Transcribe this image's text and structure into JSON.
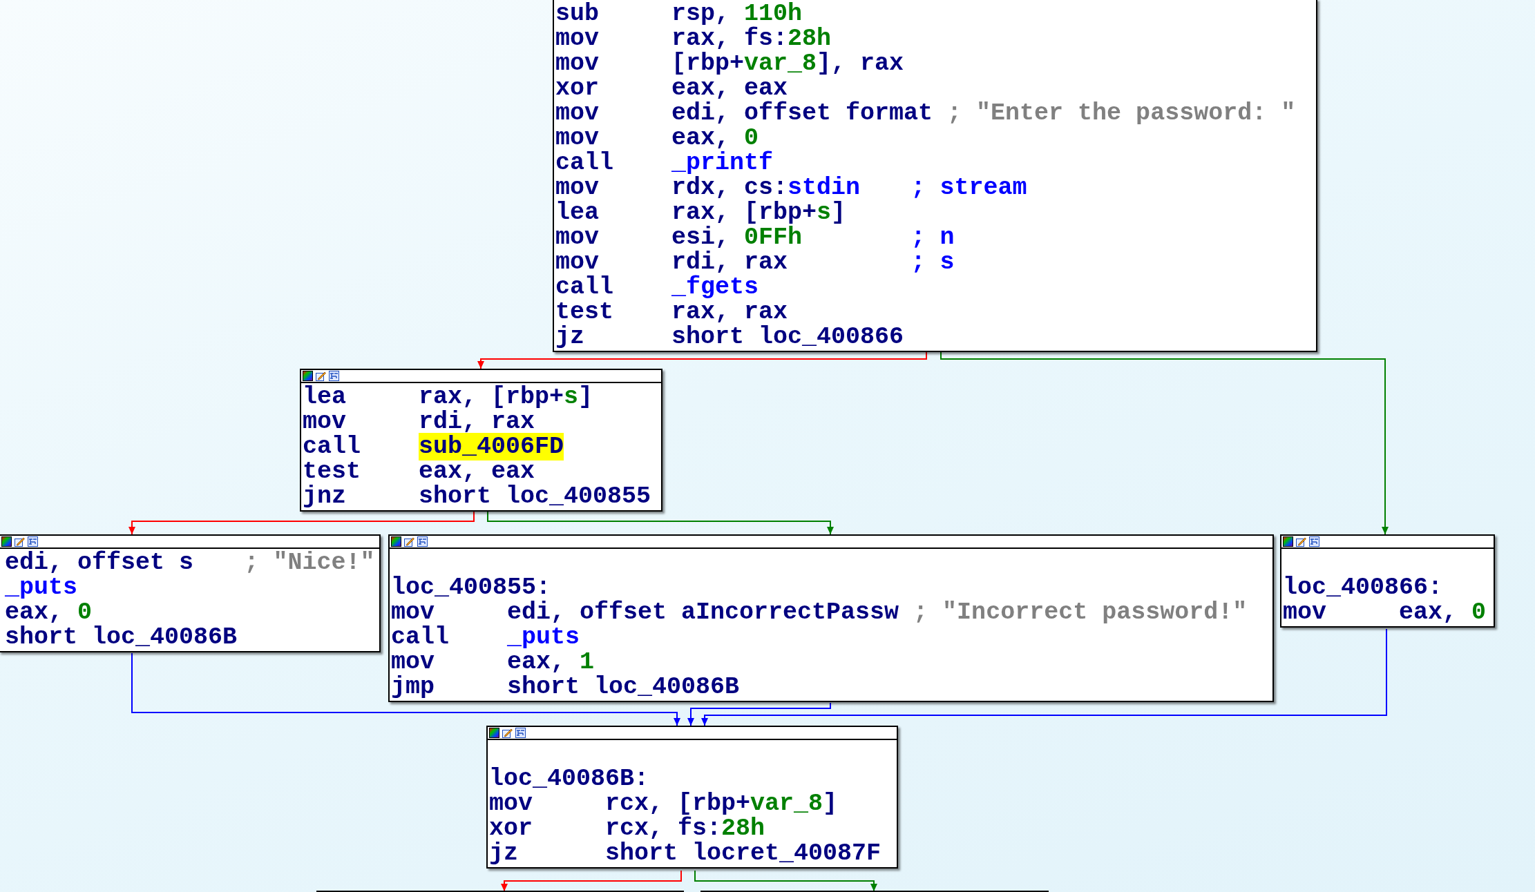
{
  "graph": {
    "blocks": [
      {
        "title_bar": false,
        "lines": [
          {
            "kind": "instr",
            "mnemonic": "sub",
            "operands": [
              {
                "text": "rsp, ",
                "kind": "plain"
              },
              {
                "text": "110h",
                "kind": "num"
              }
            ]
          },
          {
            "kind": "instr",
            "mnemonic": "mov",
            "operands": [
              {
                "text": "rax, fs:",
                "kind": "plain"
              },
              {
                "text": "28h",
                "kind": "num"
              }
            ]
          },
          {
            "kind": "instr",
            "mnemonic": "mov",
            "operands": [
              {
                "text": "[rbp+",
                "kind": "plain"
              },
              {
                "text": "var_8",
                "kind": "num"
              },
              {
                "text": "], rax",
                "kind": "plain"
              }
            ]
          },
          {
            "kind": "instr",
            "mnemonic": "xor",
            "operands": [
              {
                "text": "eax, eax",
                "kind": "plain"
              }
            ]
          },
          {
            "kind": "instr",
            "mnemonic": "mov",
            "operands": [
              {
                "text": "edi, offset format",
                "kind": "plain"
              }
            ],
            "comment": {
              "text": "; \"Enter the password: \"",
              "kind": "string"
            }
          },
          {
            "kind": "instr",
            "mnemonic": "mov",
            "operands": [
              {
                "text": "eax, ",
                "kind": "plain"
              },
              {
                "text": "0",
                "kind": "num"
              }
            ]
          },
          {
            "kind": "instr",
            "mnemonic": "call",
            "operands": [
              {
                "text": "_printf",
                "kind": "name"
              }
            ]
          },
          {
            "kind": "instr",
            "mnemonic": "mov",
            "operands": [
              {
                "text": "rdx, cs:",
                "kind": "plain"
              },
              {
                "text": "stdin",
                "kind": "name"
              }
            ],
            "comment": {
              "text": "; stream",
              "kind": "name"
            }
          },
          {
            "kind": "instr",
            "mnemonic": "lea",
            "operands": [
              {
                "text": "rax, [rbp+",
                "kind": "plain"
              },
              {
                "text": "s",
                "kind": "num"
              },
              {
                "text": "]",
                "kind": "plain"
              }
            ]
          },
          {
            "kind": "instr",
            "mnemonic": "mov",
            "operands": [
              {
                "text": "esi, ",
                "kind": "plain"
              },
              {
                "text": "0FFh",
                "kind": "num"
              }
            ],
            "comment": {
              "text": "; n",
              "kind": "name"
            }
          },
          {
            "kind": "instr",
            "mnemonic": "mov",
            "operands": [
              {
                "text": "rdi, rax",
                "kind": "plain"
              }
            ],
            "comment": {
              "text": "; s",
              "kind": "name"
            }
          },
          {
            "kind": "instr",
            "mnemonic": "call",
            "operands": [
              {
                "text": "_fgets",
                "kind": "name"
              }
            ]
          },
          {
            "kind": "instr",
            "mnemonic": "test",
            "operands": [
              {
                "text": "rax, rax",
                "kind": "plain"
              }
            ]
          },
          {
            "kind": "instr",
            "mnemonic": "jz",
            "operands": [
              {
                "text": "short loc_400866",
                "kind": "plain"
              }
            ]
          }
        ]
      },
      {
        "title_bar": true,
        "lines": [
          {
            "kind": "instr",
            "mnemonic": "lea",
            "operands": [
              {
                "text": "rax, [rbp+",
                "kind": "plain"
              },
              {
                "text": "s",
                "kind": "num"
              },
              {
                "text": "]",
                "kind": "plain"
              }
            ]
          },
          {
            "kind": "instr",
            "mnemonic": "mov",
            "operands": [
              {
                "text": "rdi, rax",
                "kind": "plain"
              }
            ]
          },
          {
            "kind": "instr",
            "mnemonic": "call",
            "operands": [
              {
                "text": "sub_4006FD",
                "kind": "highlight"
              }
            ]
          },
          {
            "kind": "instr",
            "mnemonic": "test",
            "operands": [
              {
                "text": "eax, eax",
                "kind": "plain"
              }
            ]
          },
          {
            "kind": "instr",
            "mnemonic": "jnz",
            "operands": [
              {
                "text": "short loc_400855",
                "kind": "plain"
              }
            ]
          }
        ]
      },
      {
        "title_bar": true,
        "lines": [
          {
            "kind": "instr",
            "operands": [
              {
                "text": "edi, offset s",
                "kind": "plain"
              }
            ],
            "comment": {
              "text": "; \"Nice!\"",
              "kind": "string"
            }
          },
          {
            "kind": "instr",
            "operands": [
              {
                "text": "_puts",
                "kind": "name"
              }
            ]
          },
          {
            "kind": "instr",
            "operands": [
              {
                "text": "eax, ",
                "kind": "plain"
              },
              {
                "text": "0",
                "kind": "num"
              }
            ]
          },
          {
            "kind": "instr",
            "operands": [
              {
                "text": "short loc_40086B",
                "kind": "plain"
              }
            ]
          }
        ]
      },
      {
        "title_bar": true,
        "lines": [
          {
            "kind": "label",
            "text": "loc_400855:"
          },
          {
            "kind": "instr",
            "mnemonic": "mov",
            "operands": [
              {
                "text": "edi, offset aIncorrectPassw",
                "kind": "plain"
              }
            ],
            "comment": {
              "text": "; \"Incorrect password!\"",
              "kind": "string"
            }
          },
          {
            "kind": "instr",
            "mnemonic": "call",
            "operands": [
              {
                "text": "_puts",
                "kind": "name"
              }
            ]
          },
          {
            "kind": "instr",
            "mnemonic": "mov",
            "operands": [
              {
                "text": "eax, ",
                "kind": "plain"
              },
              {
                "text": "1",
                "kind": "num"
              }
            ]
          },
          {
            "kind": "instr",
            "mnemonic": "jmp",
            "operands": [
              {
                "text": "short loc_40086B",
                "kind": "plain"
              }
            ]
          }
        ]
      },
      {
        "title_bar": true,
        "lines": [
          {
            "kind": "label",
            "text": "loc_400866:"
          },
          {
            "kind": "instr",
            "mnemonic": "mov",
            "operands": [
              {
                "text": "eax, ",
                "kind": "plain"
              },
              {
                "text": "0",
                "kind": "num"
              }
            ]
          }
        ]
      },
      {
        "title_bar": true,
        "lines": [
          {
            "kind": "label",
            "text": "loc_40086B:"
          },
          {
            "kind": "instr",
            "mnemonic": "mov",
            "operands": [
              {
                "text": "rcx, [rbp+",
                "kind": "plain"
              },
              {
                "text": "var_8",
                "kind": "num"
              },
              {
                "text": "]",
                "kind": "plain"
              }
            ]
          },
          {
            "kind": "instr",
            "mnemonic": "xor",
            "operands": [
              {
                "text": "rcx, fs:",
                "kind": "plain"
              },
              {
                "text": "28h",
                "kind": "num"
              }
            ]
          },
          {
            "kind": "instr",
            "mnemonic": "jz",
            "operands": [
              {
                "text": "short locret_40087F",
                "kind": "plain"
              }
            ]
          }
        ]
      }
    ],
    "edges": [
      {
        "color": "#ff0000"
      },
      {
        "color": "#008000"
      },
      {
        "color": "#ff0000"
      },
      {
        "color": "#008000"
      },
      {
        "color": "#0000ff"
      },
      {
        "color": "#0000ff"
      },
      {
        "color": "#0000ff"
      },
      {
        "color": "#ff0000"
      },
      {
        "color": "#008000"
      }
    ]
  }
}
